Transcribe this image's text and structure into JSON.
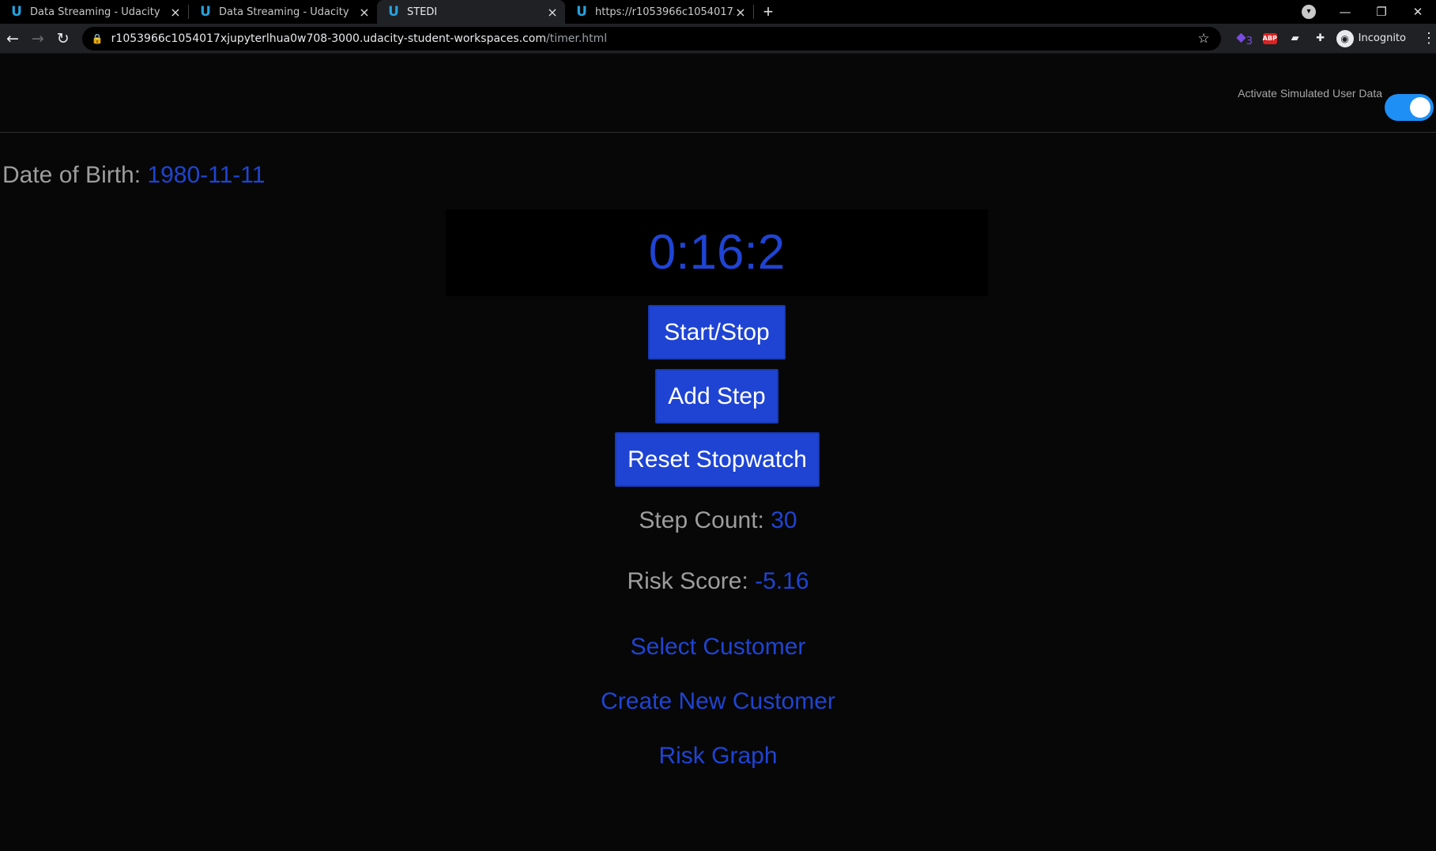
{
  "browser": {
    "tabs": [
      {
        "title": "Data Streaming - Udacity",
        "icon": "udacity-icon",
        "active": false
      },
      {
        "title": "Data Streaming - Udacity",
        "icon": "udacity-icon",
        "active": false
      },
      {
        "title": "STEDI",
        "icon": "udacity-icon",
        "active": true
      },
      {
        "title": "https://r1053966c1054017xjupyt",
        "icon": "udacity-icon",
        "active": false
      }
    ],
    "url_host": "r1053966c1054017xjupyterlhua0w708-3000.udacity-student-workspaces.com",
    "url_path": "/timer.html",
    "extension_badge": "3",
    "abp_label": "ABP",
    "profile_label": "Incognito"
  },
  "page": {
    "simulation_toggle": {
      "label": "Activate Simulated User Data",
      "enabled": true
    },
    "dob_label": "Date of Birth:",
    "dob_value": "1980-11-11",
    "timer": "0:16:2",
    "buttons": {
      "start_stop": "Start/Stop",
      "add_step": "Add Step",
      "reset": "Reset Stopwatch"
    },
    "step_count_label": "Step Count:",
    "step_count_value": "30",
    "risk_score_label": "Risk Score:",
    "risk_score_value": "-5.16",
    "links": {
      "select_customer": "Select Customer",
      "create_customer": "Create New Customer",
      "risk_graph": "Risk Graph"
    }
  },
  "colors": {
    "accent_blue": "#1f44d3",
    "toggle_blue": "#1e8ff5",
    "background": "#070707"
  }
}
